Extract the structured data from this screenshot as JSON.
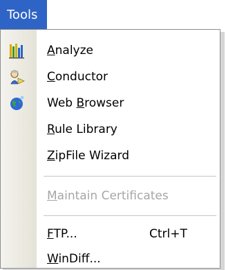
{
  "menu": {
    "title": "Tools",
    "groups": [
      [
        {
          "label": "Analyze",
          "accel": "A",
          "rest": "nalyze",
          "icon": "bar-chart-icon"
        },
        {
          "label": "Conductor",
          "accel": "C",
          "rest": "onductor",
          "icon": "conductor-icon"
        },
        {
          "label": "Web Browser",
          "pre": "Web ",
          "accel": "B",
          "rest": "rowser",
          "icon": "globe-icon"
        },
        {
          "label": "Rule Library",
          "accel": "R",
          "rest": "ule Library"
        },
        {
          "label": "ZipFile Wizard",
          "accel": "Z",
          "rest": "ipFile Wizard"
        }
      ],
      [
        {
          "label": "Maintain Certificates",
          "accel": "M",
          "rest": "aintain Certificates",
          "disabled": true
        }
      ],
      [
        {
          "label": "FTP...",
          "accel": "F",
          "rest": "TP...",
          "shortcut": "Ctrl+T"
        },
        {
          "label": "WinDiff...",
          "accel": "W",
          "rest": "inDiff..."
        }
      ]
    ]
  }
}
